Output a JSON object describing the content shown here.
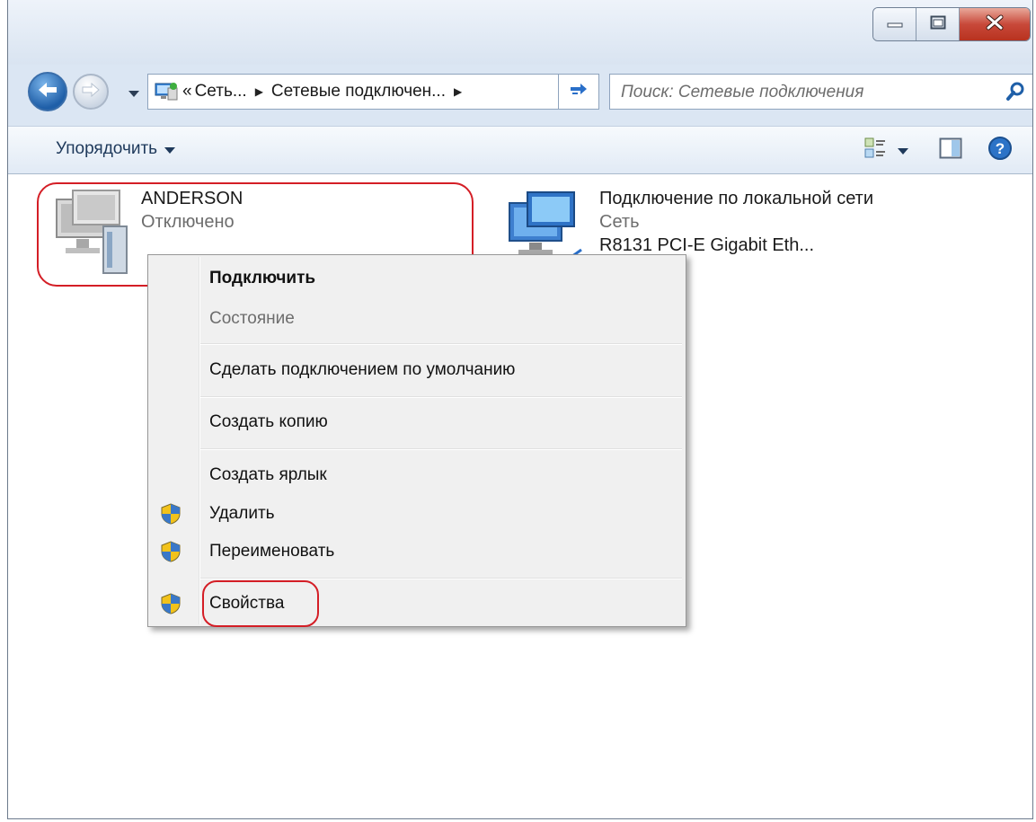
{
  "window": {
    "minimize_icon": "minimize-icon",
    "maximize_icon": "maximize-icon",
    "close_icon": "close-icon"
  },
  "address": {
    "overflow": "«",
    "crumbs": [
      "Сеть...",
      "Сетевые подключен..."
    ],
    "separator": "▶",
    "refresh_icon": "refresh-icon"
  },
  "search": {
    "placeholder": "Поиск: Сетевые подключения",
    "icon": "search-icon"
  },
  "toolbar": {
    "organize_label": "Упорядочить",
    "caret": "▼",
    "view_icon": "view-options-icon",
    "preview_icon": "preview-pane-icon",
    "help_icon": "help-icon"
  },
  "connections": [
    {
      "name": "ANDERSON",
      "status": "Отключено",
      "device": ""
    },
    {
      "name": "Подключение по локальной сети",
      "status": "Сеть",
      "device": "R8131 PCI-E Gigabit Eth..."
    }
  ],
  "context_menu": {
    "items": [
      {
        "label": "Подключить",
        "bold": true
      },
      {
        "label": "Состояние",
        "disabled": true
      },
      {
        "label": "Сделать подключением по умолчанию"
      },
      {
        "label": "Создать копию"
      },
      {
        "label": "Создать ярлык"
      },
      {
        "label": "Удалить",
        "icon": "uac-shield-icon"
      },
      {
        "label": "Переименовать",
        "icon": "uac-shield-icon"
      },
      {
        "label": "Свойства",
        "icon": "uac-shield-icon"
      }
    ]
  },
  "colors": {
    "highlight": "#d41e26",
    "toolbar_text": "#1e395b",
    "window_frame": "#dbe6f3"
  }
}
